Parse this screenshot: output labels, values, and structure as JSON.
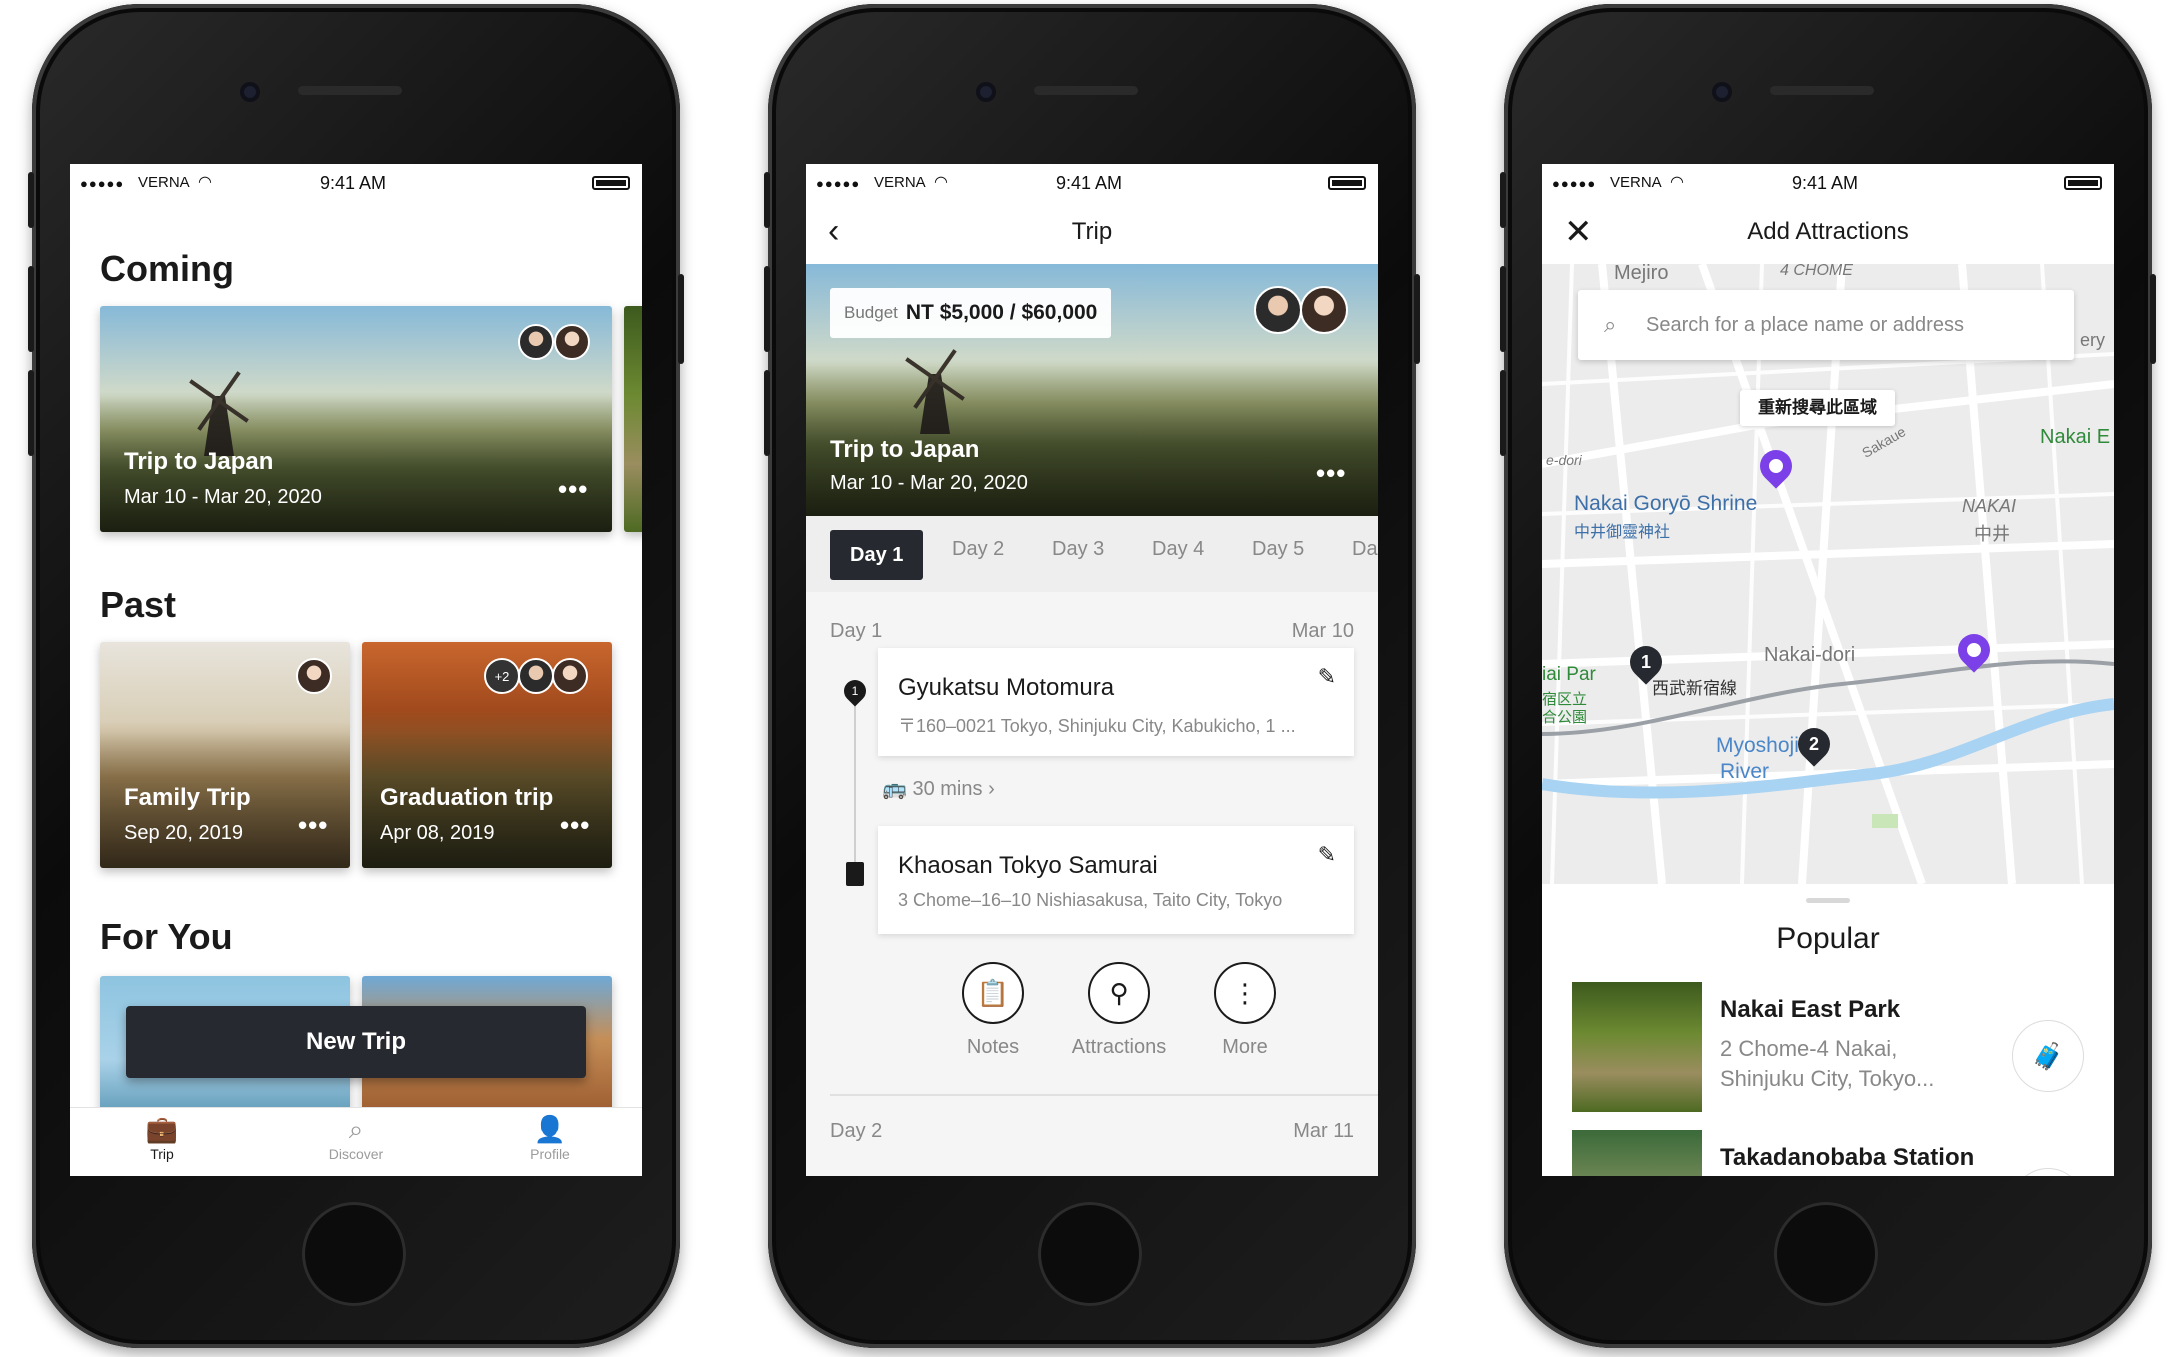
{
  "status_bar": {
    "signal": "●●●●●",
    "carrier": "VERNA",
    "time": "9:41 AM"
  },
  "colors": {
    "accent_dark": "#262a30",
    "map_pin_purple": "#7b40e8",
    "muted_text": "#888888"
  },
  "screen1": {
    "sections": {
      "coming": "Coming",
      "past": "Past",
      "for_you": "For You"
    },
    "coming_card": {
      "title": "Trip to Japan",
      "dates": "Mar 10 - Mar 20, 2020",
      "more": "•••"
    },
    "past_cards": [
      {
        "title": "Family Trip",
        "date": "Sep 20, 2019",
        "more": "•••"
      },
      {
        "title": "Graduation trip",
        "date": "Apr 08, 2019",
        "more": "•••",
        "extra_members": "+2"
      }
    ],
    "new_trip_label": "New Trip",
    "tabs": [
      {
        "label": "Trip",
        "icon": "briefcase-icon"
      },
      {
        "label": "Discover",
        "icon": "search-icon"
      },
      {
        "label": "Profile",
        "icon": "person-icon"
      }
    ]
  },
  "screen2": {
    "title": "Trip",
    "budget_label": "Budget",
    "budget_value": "NT $5,000 / $60,000",
    "trip_title": "Trip to Japan",
    "trip_dates": "Mar 10 - Mar 20, 2020",
    "more": "•••",
    "day_tabs": [
      "Day 1",
      "Day 2",
      "Day 3",
      "Day 4",
      "Day 5",
      "Da"
    ],
    "day1": {
      "label": "Day 1",
      "date": "Mar 10"
    },
    "stops": [
      {
        "name": "Gyukatsu Motomura",
        "address": "〒160–0021 Tokyo, Shinjuku City, Kabukicho, 1 ..."
      },
      {
        "name": "Khaosan Tokyo Samurai",
        "address": "3 Chome–16–10 Nishiasakusa, Taito City, Tokyo"
      }
    ],
    "transit": "30 mins",
    "transit_chevron": "›",
    "actions": [
      {
        "label": "Notes",
        "icon": "notes-icon"
      },
      {
        "label": "Attractions",
        "icon": "location-pin-icon"
      },
      {
        "label": "More",
        "icon": "more-vertical-icon"
      }
    ],
    "day2": {
      "label": "Day 2",
      "date": "Mar 11"
    }
  },
  "screen3": {
    "title": "Add Attractions",
    "search_placeholder": "Search for a place name or address",
    "research_label": "重新搜尋此區域",
    "map_labels": {
      "mejiro": "Mejiro",
      "chome": "4 CHOME",
      "nakai_goryo": "Nakai Goryō Shrine",
      "nakai_goryo_jp": "中井御靈神社",
      "nakai_area": "NAKAI",
      "nakai_area_jp": "中井",
      "nakai_e": "Nakai E",
      "nakai_dori": "Nakai-dori",
      "seibu": "西武新宿線",
      "myoshoji": "Myoshoji",
      "river": "River",
      "e_dori": "e-dori",
      "sakaue": "Sakaue",
      "park_partial": "iai Par",
      "park_jp_1": "宿区立",
      "park_jp_2": "合公園",
      "ery": "ery",
      "pin_1": "1",
      "pin_2": "2"
    },
    "popular_heading": "Popular",
    "places": [
      {
        "name": "Nakai East Park",
        "address": "2 Chome-4 Nakai, Shinjuku City, Tokyo..."
      },
      {
        "name": "Takadanobaba Station",
        "address": ""
      }
    ]
  }
}
